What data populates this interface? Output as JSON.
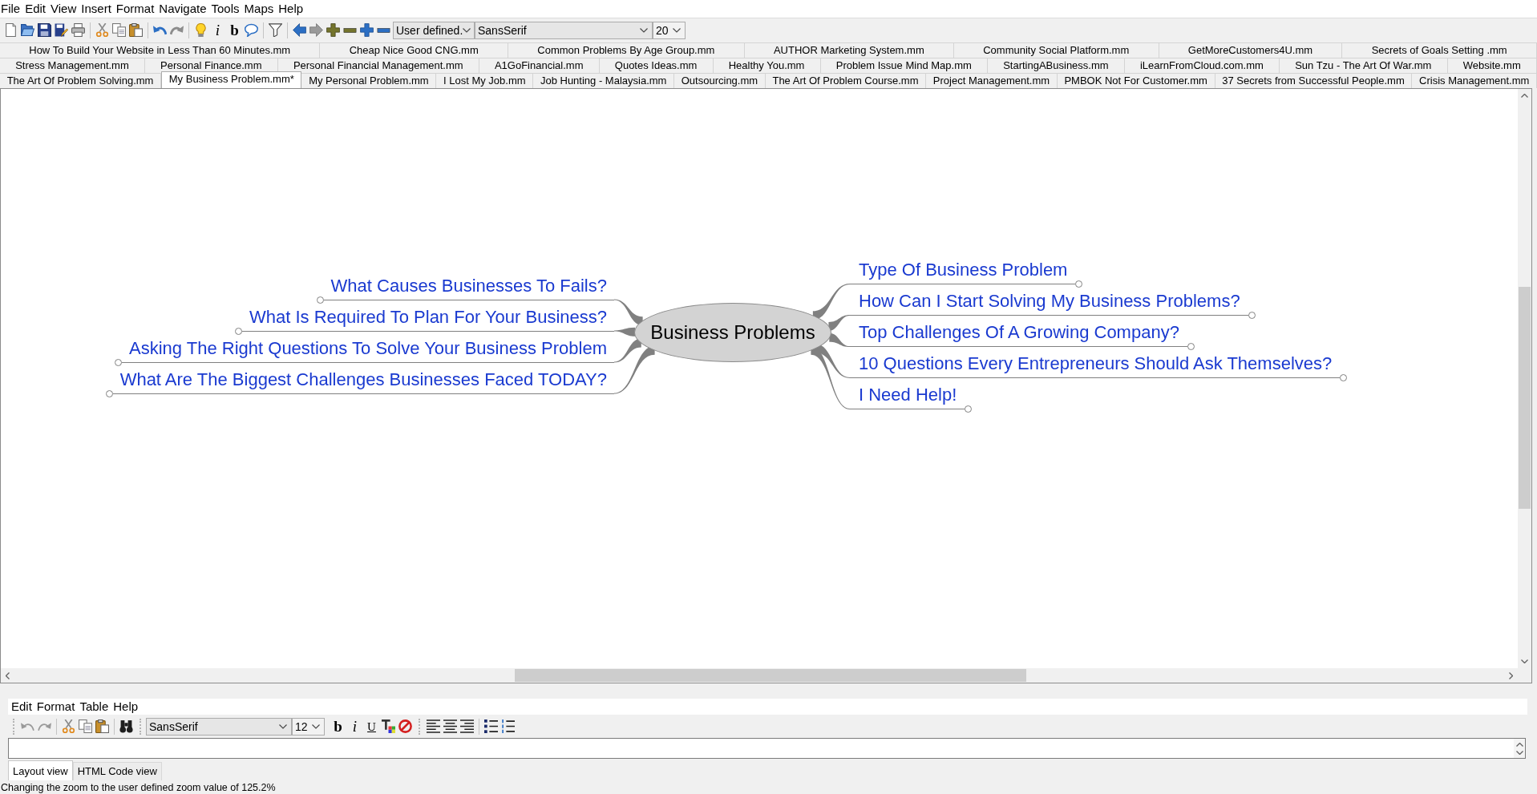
{
  "menu_bar": [
    "File",
    "Edit",
    "View",
    "Insert",
    "Format",
    "Navigate",
    "Tools",
    "Maps",
    "Help"
  ],
  "toolbar": {
    "glyph_buttons": [
      {
        "text": "i",
        "kind": "italic"
      },
      {
        "text": "b",
        "kind": "bold"
      }
    ],
    "zoom_select": "User defined.",
    "font_select": "SansSerif",
    "size_select": "20"
  },
  "tab_rows": [
    [
      {
        "label": "How To Build Your Website in Less Than 60 Minutes.mm",
        "selected": false
      },
      {
        "label": "Cheap Nice Good CNG.mm",
        "selected": false
      },
      {
        "label": "Common Problems By Age Group.mm",
        "selected": false
      },
      {
        "label": "AUTHOR Marketing System.mm",
        "selected": false
      },
      {
        "label": "Community Social Platform.mm",
        "selected": false
      },
      {
        "label": "GetMoreCustomers4U.mm",
        "selected": false
      },
      {
        "label": "Secrets of Goals Setting .mm",
        "selected": false
      }
    ],
    [
      {
        "label": "Stress Management.mm",
        "selected": false
      },
      {
        "label": "Personal Finance.mm",
        "selected": false
      },
      {
        "label": "Personal Financial Management.mm",
        "selected": false
      },
      {
        "label": "A1GoFinancial.mm",
        "selected": false
      },
      {
        "label": "Quotes Ideas.mm",
        "selected": false
      },
      {
        "label": "Healthy You.mm",
        "selected": false
      },
      {
        "label": "Problem Issue Mind Map.mm",
        "selected": false
      },
      {
        "label": "StartingABusiness.mm",
        "selected": false
      },
      {
        "label": "iLearnFromCloud.com.mm",
        "selected": false
      },
      {
        "label": "Sun Tzu - The Art Of War.mm",
        "selected": false
      },
      {
        "label": "Website.mm",
        "selected": false
      }
    ],
    [
      {
        "label": "The Art Of Problem Solving.mm",
        "selected": false
      },
      {
        "label": "My Business Problem.mm*",
        "selected": true
      },
      {
        "label": "My Personal Problem.mm",
        "selected": false
      },
      {
        "label": "I Lost My Job.mm",
        "selected": false
      },
      {
        "label": "Job Hunting - Malaysia.mm",
        "selected": false
      },
      {
        "label": "Outsourcing.mm",
        "selected": false
      },
      {
        "label": "The Art Of Problem Course.mm",
        "selected": false
      },
      {
        "label": "Project Management.mm",
        "selected": false
      },
      {
        "label": "PMBOK Not For Customer.mm",
        "selected": false
      },
      {
        "label": "37 Secrets from Successful People.mm",
        "selected": false
      },
      {
        "label": "Crisis Management.mm",
        "selected": false
      }
    ]
  ],
  "mind_map": {
    "root": "Business Problems",
    "right_children": [
      "Type Of Business Problem",
      "How Can I Start Solving My Business Problems?",
      "Top Challenges Of A Growing Company?",
      "10 Questions Every Entrepreneurs Should Ask Themselves?",
      "I Need Help!"
    ],
    "left_children": [
      "What Causes Businesses To Fails?",
      "What Is Required To Plan For Your Business?",
      "Asking The Right Questions To Solve Your Business Problem",
      "What Are The Biggest Challenges Businesses Faced TODAY?"
    ]
  },
  "editor": {
    "menu_bar": [
      "Edit",
      "Format",
      "Table",
      "Help"
    ],
    "toolbar": {
      "font_select": "SansSerif",
      "size_select": "12",
      "glyph_buttons": [
        {
          "text": "b",
          "kind": "bold"
        },
        {
          "text": "i",
          "kind": "italic"
        },
        {
          "text": "U",
          "kind": "underline"
        }
      ]
    },
    "view_tabs": [
      {
        "label": "Layout view",
        "selected": true
      },
      {
        "label": "HTML Code view",
        "selected": false
      }
    ]
  },
  "status_bar": "Changing the zoom to the user defined zoom value of 125.2%"
}
